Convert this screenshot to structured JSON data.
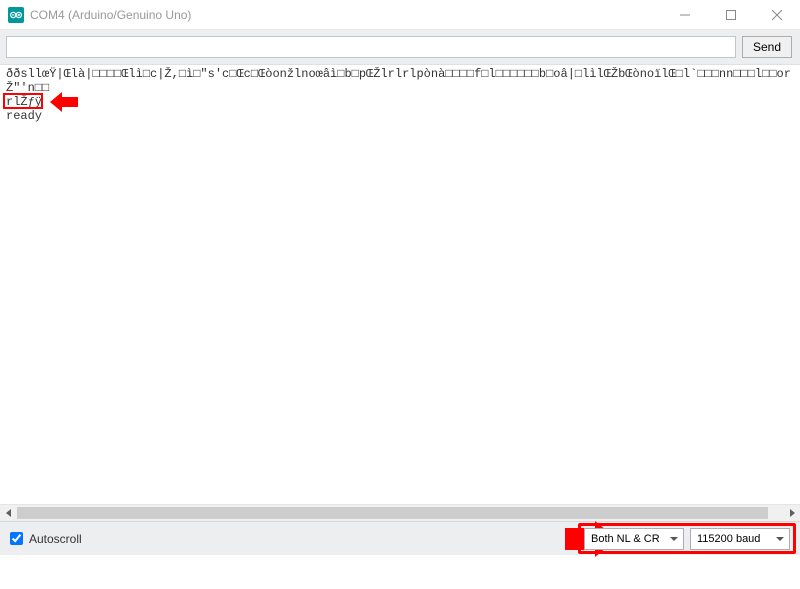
{
  "titlebar": {
    "title": "COM4 (Arduino/Genuino Uno)"
  },
  "input": {
    "value": "",
    "placeholder": "",
    "send_label": "Send"
  },
  "output": {
    "line1": "ððsllœŸ|Œlà|□□□□Œlì□c|Ž,□ì□\"s'c□Œc□Œòonžlnoœâì□b□pŒŽlrlrlpònà□□□□f□l□□□□□□b□oâ|□lìlŒŽbŒònoïlŒ□l`□□□nn□□□l□□orŽ\"'n□□",
    "line2": "rlŽƒÿ",
    "line3": "ready"
  },
  "footer": {
    "autoscroll_label": "Autoscroll",
    "autoscroll_checked": true,
    "line_ending": "Both NL & CR",
    "baud_rate": "115200 baud"
  }
}
